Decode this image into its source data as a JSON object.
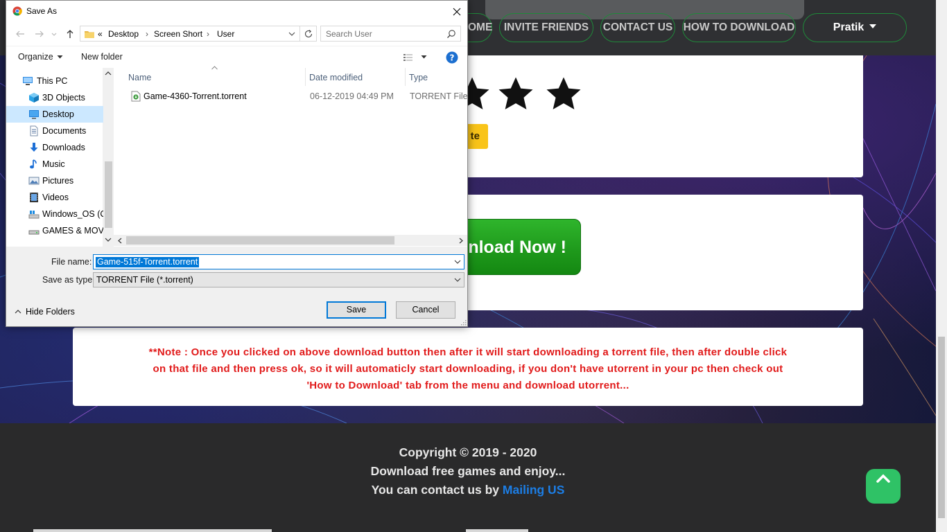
{
  "website": {
    "nav": {
      "home": "OME",
      "invite_friends": "INVITE FRIENDS",
      "contact_us": "CONTACT US",
      "how_to_download": "HOW TO DOWNLOAD",
      "user": "Pratik"
    },
    "rating": {
      "stars_visible": 3,
      "button_partial": "te"
    },
    "download_button_partial": "nload  Now !",
    "note": "**Note : Once you clicked on above download button then after it will start downloading a torrent file, then after double click on that file and then press ok, so it will automaticly start downloading, if you don't have utorrent in your pc then check out 'How to Download' tab from the menu and download utorrent...",
    "footer": {
      "copyright": "Copyright © 2019 - 2020",
      "tagline": "Download free games and enjoy...",
      "contact_prefix": "You can contact us by",
      "contact_link": "Mailing US"
    },
    "colors": {
      "accent_green": "#2fc266",
      "note_red": "#e11a1a",
      "link_blue": "#1c7ee6"
    }
  },
  "dialog": {
    "title": "Save As",
    "address": {
      "overflow": "«",
      "crumbs": [
        "Desktop",
        "Screen Short",
        "User"
      ]
    },
    "search_placeholder": "Search User",
    "toolbar": {
      "organize": "Organize",
      "new_folder": "New folder"
    },
    "nav_items": [
      {
        "label": "This PC",
        "icon": "pc-icon"
      },
      {
        "label": "3D Objects",
        "icon": "cube-icon"
      },
      {
        "label": "Desktop",
        "icon": "desktop-icon",
        "selected": true
      },
      {
        "label": "Documents",
        "icon": "documents-icon"
      },
      {
        "label": "Downloads",
        "icon": "download-arrow-icon"
      },
      {
        "label": "Music",
        "icon": "music-note-icon"
      },
      {
        "label": "Pictures",
        "icon": "pictures-icon"
      },
      {
        "label": "Videos",
        "icon": "videos-icon"
      },
      {
        "label": "Windows_OS (C:",
        "icon": "drive-icon"
      },
      {
        "label": "GAMES & MOVI",
        "icon": "drive-icon"
      }
    ],
    "columns": {
      "name": "Name",
      "date_modified": "Date modified",
      "type": "Type"
    },
    "files": [
      {
        "name": "Game-4360-Torrent.torrent",
        "date": "06-12-2019 04:49 PM",
        "type": "TORRENT File"
      }
    ],
    "file_name_label": "File name:",
    "file_name_value": "Game-515f-Torrent.torrent",
    "save_type_label": "Save as type:",
    "save_type_value": "TORRENT File (*.torrent)",
    "hide_folders": "Hide Folders",
    "save_button": "Save",
    "cancel_button": "Cancel"
  }
}
